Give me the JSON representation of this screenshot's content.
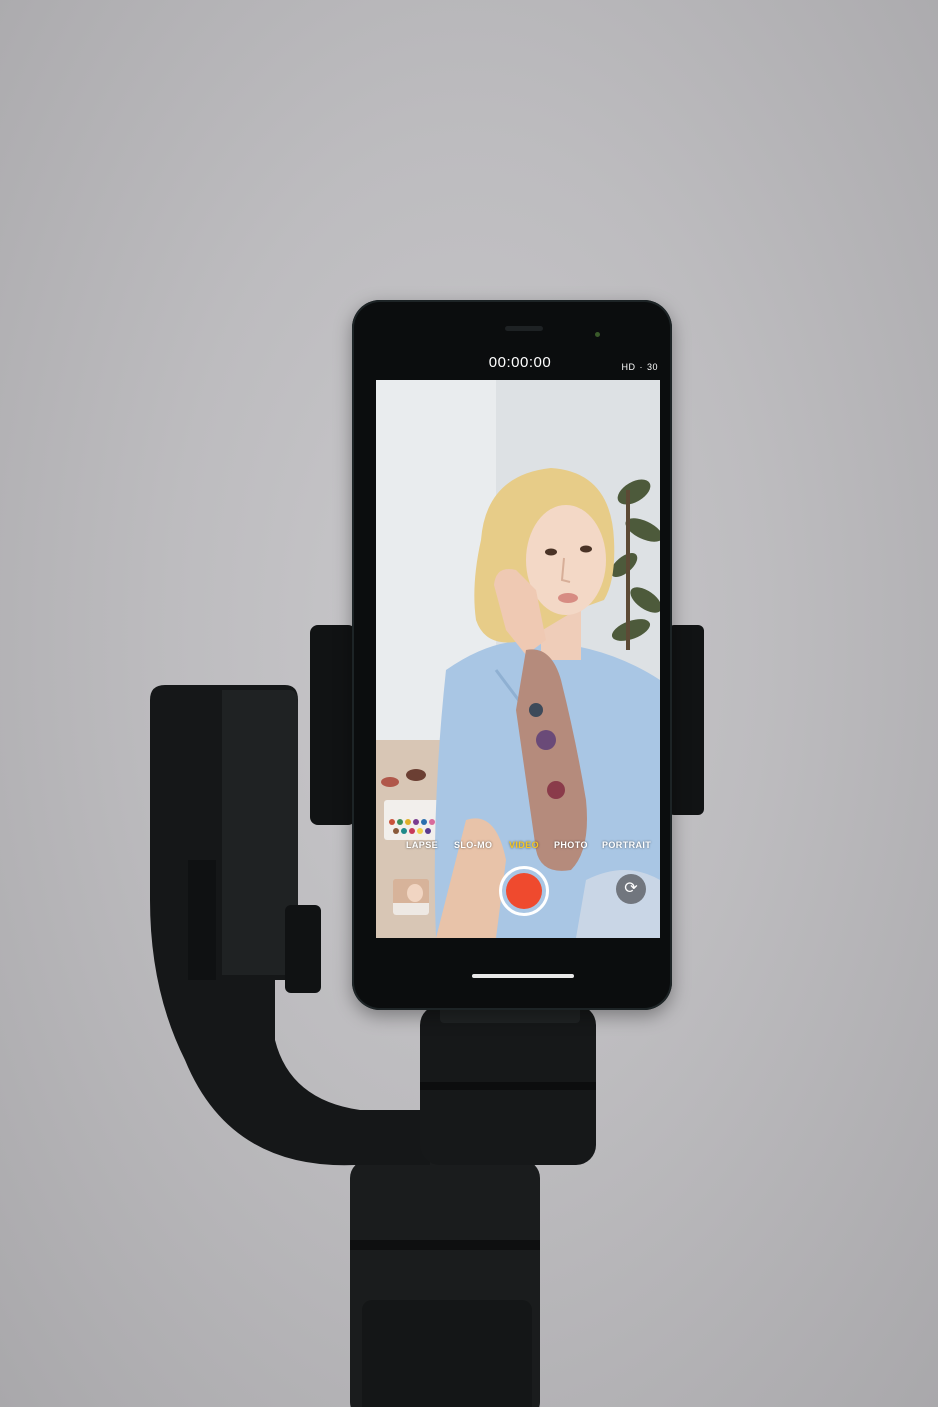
{
  "camera_app": {
    "timer": "00:00:00",
    "resolution": "HD",
    "separator": "·",
    "frame_rate": "30",
    "modes": [
      {
        "label": "LAPSE",
        "active": false
      },
      {
        "label": "SLO-MO",
        "active": false
      },
      {
        "label": "VIDEO",
        "active": true
      },
      {
        "label": "PHOTO",
        "active": false
      },
      {
        "label": "PORTRAIT",
        "active": false
      }
    ],
    "record_color": "#ef4a2e",
    "active_mode_color": "#f5c623",
    "icons": [
      "last-photo-thumbnail",
      "record-button",
      "camera-flip-icon"
    ]
  },
  "colors": {
    "background": "#bdbcbf",
    "device": "#0b0d0e"
  }
}
